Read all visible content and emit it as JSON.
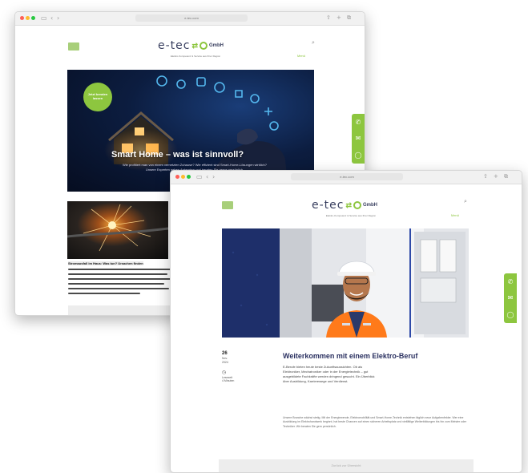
{
  "win1": {
    "address": "e-tec.com",
    "logo": {
      "main": "e-tec",
      "sub": "GmbH"
    },
    "tagline": "Elektro-Kompetenz & Service aus Ihrer Region",
    "green_link": "Menü",
    "hero": {
      "badge": "Jetzt beraten lassen",
      "title": "Smart Home – was ist sinnvoll?",
      "text": "Wie profitiert man von einem vernetzten Zuhause? Wie effizient sind Smart-Home-Lösungen wirklich? Unsere Experten geben Antworten und beraten Sie gerne persönlich."
    },
    "article_heading": "Stromausfall im Haus: Was tun? Ursachen finden"
  },
  "win2": {
    "address": "e-tec.com",
    "logo": {
      "main": "e-tec",
      "sub": "GmbH"
    },
    "tagline": "Elektro-Kompetenz & Service aus Ihrer Region",
    "green_link": "Menü",
    "title": "Weiterkommen mit einem Elektro-Beruf",
    "intro": "E-Berufe bieten heute beste Zukunftsaussichten. Ob als Elektroniker, Mechatroniker oder in der Energietechnik – gut ausgebildete Fachkräfte werden dringend gesucht. Ein Überblick über Ausbildung, Karrierewege und Verdienst.",
    "body": "Unsere Branche wächst stetig. Mit der Energiewende, Elektromobilität und Smart-Home-Technik entstehen täglich neue Aufgabenfelder. Wer eine Ausbildung im Elektrohandwerk beginnt, hat beste Chancen auf einen sicheren Arbeitsplatz und vielfältige Weiterbildungen bis hin zum Meister oder Techniker. Wir beraten Sie gern persönlich.",
    "meta": {
      "day": "26",
      "month": "Nov.",
      "year": "2024",
      "label1": "Lesezeit",
      "label2": "4 Minuten"
    },
    "footer_link": "Zurück zur Übersicht"
  },
  "colors": {
    "accent": "#8dc63f",
    "navy": "#2a3060"
  },
  "icons": [
    "hamburger-icon",
    "search-icon",
    "user-icon",
    "phone-icon",
    "mail-icon",
    "whatsapp-icon",
    "back-arrow-icon",
    "forward-arrow-icon",
    "share-icon",
    "tabs-icon",
    "sidebar-icon"
  ]
}
